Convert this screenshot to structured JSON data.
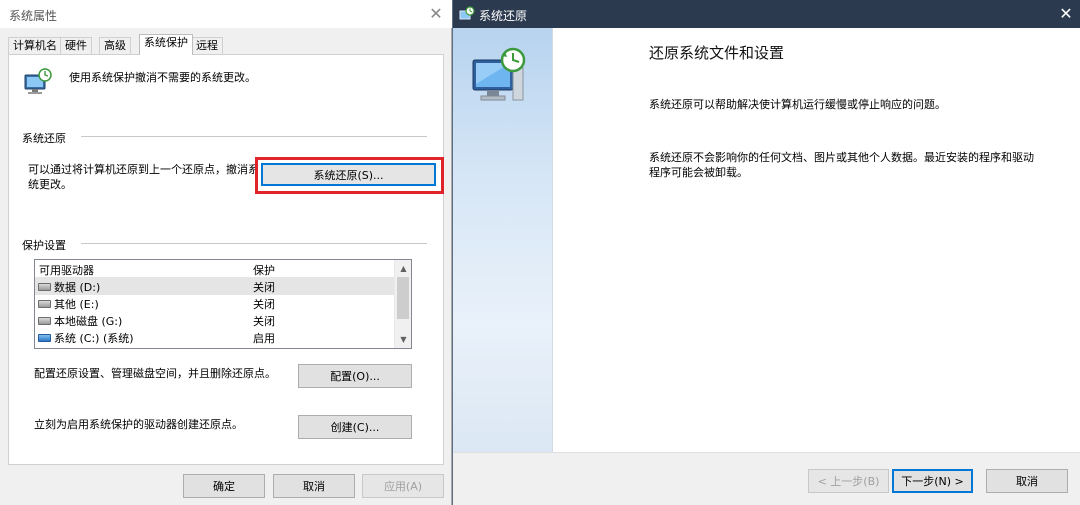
{
  "left_window": {
    "title": "系统属性",
    "tabs": [
      "计算机名",
      "硬件",
      "高级",
      "系统保护",
      "远程"
    ],
    "active_tab_index": 3,
    "intro_text": "使用系统保护撤消不需要的系统更改。",
    "restore_section": {
      "label": "系统还原",
      "text_line1": "可以通过将计算机还原到上一个还原点，撤消系",
      "text_line2": "统更改。",
      "button_label": "系统还原(S)..."
    },
    "protection_section": {
      "label": "保护设置",
      "columns": [
        "可用驱动器",
        "保护"
      ],
      "drives": [
        {
          "name": "数据 (D:)",
          "protection": "关闭",
          "selected": true,
          "icon": "drive-icon"
        },
        {
          "name": "其他 (E:)",
          "protection": "关闭",
          "selected": false,
          "icon": "drive-icon"
        },
        {
          "name": "本地磁盘 (G:)",
          "protection": "关闭",
          "selected": false,
          "icon": "drive-icon"
        },
        {
          "name": "系统 (C:) (系统)",
          "protection": "启用",
          "selected": false,
          "icon": "system-drive-icon"
        }
      ],
      "configure_text": "配置还原设置、管理磁盘空间，并且删除还原点。",
      "configure_button": "配置(O)...",
      "create_text": "立刻为启用系统保护的驱动器创建还原点。",
      "create_button": "创建(C)..."
    },
    "footer": {
      "ok": "确定",
      "cancel": "取消",
      "apply": "应用(A)"
    }
  },
  "right_window": {
    "title": "系统还原",
    "heading": "还原系统文件和设置",
    "paragraph1": "系统还原可以帮助解决使计算机运行缓慢或停止响应的问题。",
    "paragraph2_line1": "系统还原不会影响你的任何文档、图片或其他个人数据。最近安装的程序和驱动",
    "paragraph2_line2": "程序可能会被卸载。",
    "buttons": {
      "back": "< 上一步(B)",
      "next": "下一步(N) >",
      "cancel": "取消"
    }
  },
  "colors": {
    "highlight_box": "#e0242b",
    "titlebar_dark": "#2b3a4e",
    "focus_blue": "#0078d7"
  }
}
